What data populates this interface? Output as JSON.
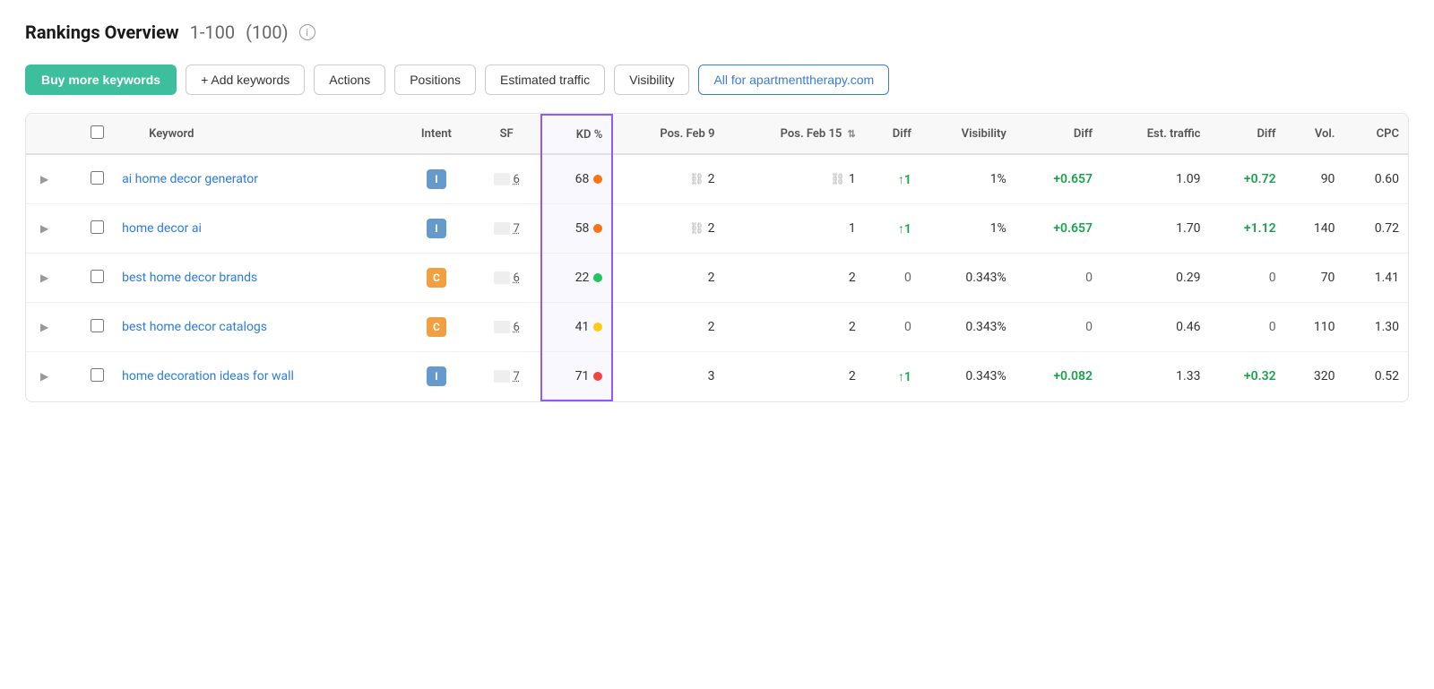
{
  "header": {
    "title": "Rankings Overview",
    "range": "1-100",
    "count": "(100)",
    "info": "i"
  },
  "toolbar": {
    "buy_keywords": "Buy more keywords",
    "add_keywords": "+ Add keywords",
    "actions": "Actions",
    "tabs": [
      "Positions",
      "Estimated traffic",
      "Visibility"
    ],
    "domain_filter": "All for apartmenttherapy.com"
  },
  "table": {
    "columns": [
      "Keyword",
      "Intent",
      "SF",
      "KD %",
      "Pos. Feb 9",
      "Pos. Feb 15",
      "Diff",
      "Visibility",
      "Diff",
      "Est. traffic",
      "Diff",
      "Vol.",
      "CPC"
    ],
    "rows": [
      {
        "keyword": "ai home decor generator",
        "intent": "I",
        "intent_type": "i",
        "sf_num": "6",
        "kd": "68",
        "kd_color": "orange",
        "pos_feb9": "2",
        "pos_feb9_chain": true,
        "pos_feb15": "1",
        "pos_feb15_chain": true,
        "diff": "↑1",
        "diff_type": "up",
        "visibility": "1%",
        "vis_diff": "+0.657",
        "vis_diff_type": "pos",
        "est_traffic": "1.09",
        "est_diff": "+0.72",
        "est_diff_type": "pos",
        "vol": "90",
        "cpc": "0.60"
      },
      {
        "keyword": "home decor ai",
        "intent": "I",
        "intent_type": "i",
        "sf_num": "7",
        "kd": "58",
        "kd_color": "orange",
        "pos_feb9": "2",
        "pos_feb9_chain": true,
        "pos_feb15": "1",
        "pos_feb15_chain": false,
        "diff": "↑1",
        "diff_type": "up",
        "visibility": "1%",
        "vis_diff": "+0.657",
        "vis_diff_type": "pos",
        "est_traffic": "1.70",
        "est_diff": "+1.12",
        "est_diff_type": "pos",
        "vol": "140",
        "cpc": "0.72"
      },
      {
        "keyword": "best home decor brands",
        "intent": "C",
        "intent_type": "c",
        "sf_num": "6",
        "kd": "22",
        "kd_color": "green",
        "pos_feb9": "2",
        "pos_feb9_chain": false,
        "pos_feb15": "2",
        "pos_feb15_chain": false,
        "diff": "0",
        "diff_type": "zero",
        "visibility": "0.343%",
        "vis_diff": "0",
        "vis_diff_type": "zero",
        "est_traffic": "0.29",
        "est_diff": "0",
        "est_diff_type": "zero",
        "vol": "70",
        "cpc": "1.41"
      },
      {
        "keyword": "best home decor catalogs",
        "intent": "C",
        "intent_type": "c",
        "sf_num": "6",
        "kd": "41",
        "kd_color": "yellow",
        "pos_feb9": "2",
        "pos_feb9_chain": false,
        "pos_feb15": "2",
        "pos_feb15_chain": false,
        "diff": "0",
        "diff_type": "zero",
        "visibility": "0.343%",
        "vis_diff": "0",
        "vis_diff_type": "zero",
        "est_traffic": "0.46",
        "est_diff": "0",
        "est_diff_type": "zero",
        "vol": "110",
        "cpc": "1.30"
      },
      {
        "keyword": "home decoration ideas for wall",
        "intent": "I",
        "intent_type": "i",
        "sf_num": "7",
        "kd": "71",
        "kd_color": "red",
        "pos_feb9": "3",
        "pos_feb9_chain": false,
        "pos_feb15": "2",
        "pos_feb15_chain": false,
        "diff": "↑1",
        "diff_type": "up",
        "visibility": "0.343%",
        "vis_diff": "+0.082",
        "vis_diff_type": "pos",
        "est_traffic": "1.33",
        "est_diff": "+0.32",
        "est_diff_type": "pos",
        "vol": "320",
        "cpc": "0.52"
      }
    ]
  }
}
